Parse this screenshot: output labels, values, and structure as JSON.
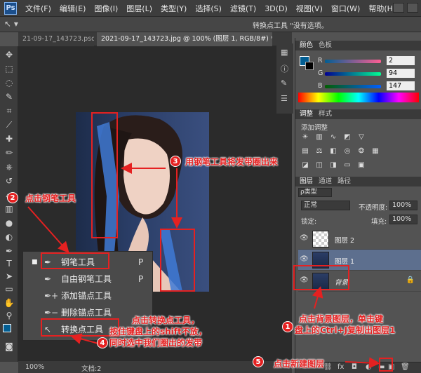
{
  "menubar": {
    "logo": "Ps",
    "items": [
      "文件(F)",
      "编辑(E)",
      "图像(I)",
      "图层(L)",
      "类型(Y)",
      "选择(S)",
      "滤镜(T)",
      "3D(D)",
      "视图(V)",
      "窗口(W)",
      "帮助(H)"
    ]
  },
  "optionsbar": {
    "text": "转换点工具 \"没有选项。"
  },
  "tabs": {
    "tab1": "21-09-17_143723.psd",
    "tab2": "2021-09-17_143723.jpg @ 100% (图层 1, RGB/8#) *",
    "close": "×"
  },
  "status": {
    "zoom": "100%",
    "doc": "文档:2"
  },
  "color_panel": {
    "tabs": [
      "颜色",
      "色板"
    ],
    "r_label": "R",
    "g_label": "G",
    "b_label": "B",
    "r": "2",
    "g": "94",
    "b": "147",
    "foreground": "#025e93"
  },
  "adjust_panel": {
    "tabs": [
      "调整",
      "样式"
    ],
    "title": "添加调整"
  },
  "layers_panel": {
    "tabs": [
      "图层",
      "通道",
      "路径"
    ],
    "filter": "ρ类型",
    "blend_mode": "正常",
    "opacity_label": "不透明度:",
    "opacity": "100%",
    "lock_label": "锁定:",
    "fill_label": "填充:",
    "fill": "100%",
    "layers": [
      {
        "name": "图层 2"
      },
      {
        "name": "图层 1"
      },
      {
        "name": "背景"
      }
    ]
  },
  "flyout": {
    "items": [
      {
        "label": "钢笔工具",
        "key": "P",
        "icon": "pen-icon"
      },
      {
        "label": "自由钢笔工具",
        "key": "P",
        "icon": "freeform-pen-icon"
      },
      {
        "label": "添加锚点工具",
        "key": "",
        "icon": "add-anchor-icon"
      },
      {
        "label": "删除锚点工具",
        "key": "",
        "icon": "delete-anchor-icon"
      },
      {
        "label": "转换点工具",
        "key": "",
        "icon": "convert-point-icon"
      }
    ]
  },
  "annotations": {
    "n1": "1",
    "n2": "2",
    "n3": "3",
    "n4": "4",
    "n5": "5",
    "a1_line1": "点击背景图层，单击键",
    "a1_line2": "盘上的Ctrl+J复制出图层1",
    "a2": "点击钢笔工具",
    "a3": "用钢笔工具将发带圈出来",
    "a4_line1": "点击转换点工具，",
    "a4_line2": "按住键盘上的shift不放，",
    "a4_line3": "同时选中我们圈出的发带",
    "a5": "点击新建图层"
  }
}
